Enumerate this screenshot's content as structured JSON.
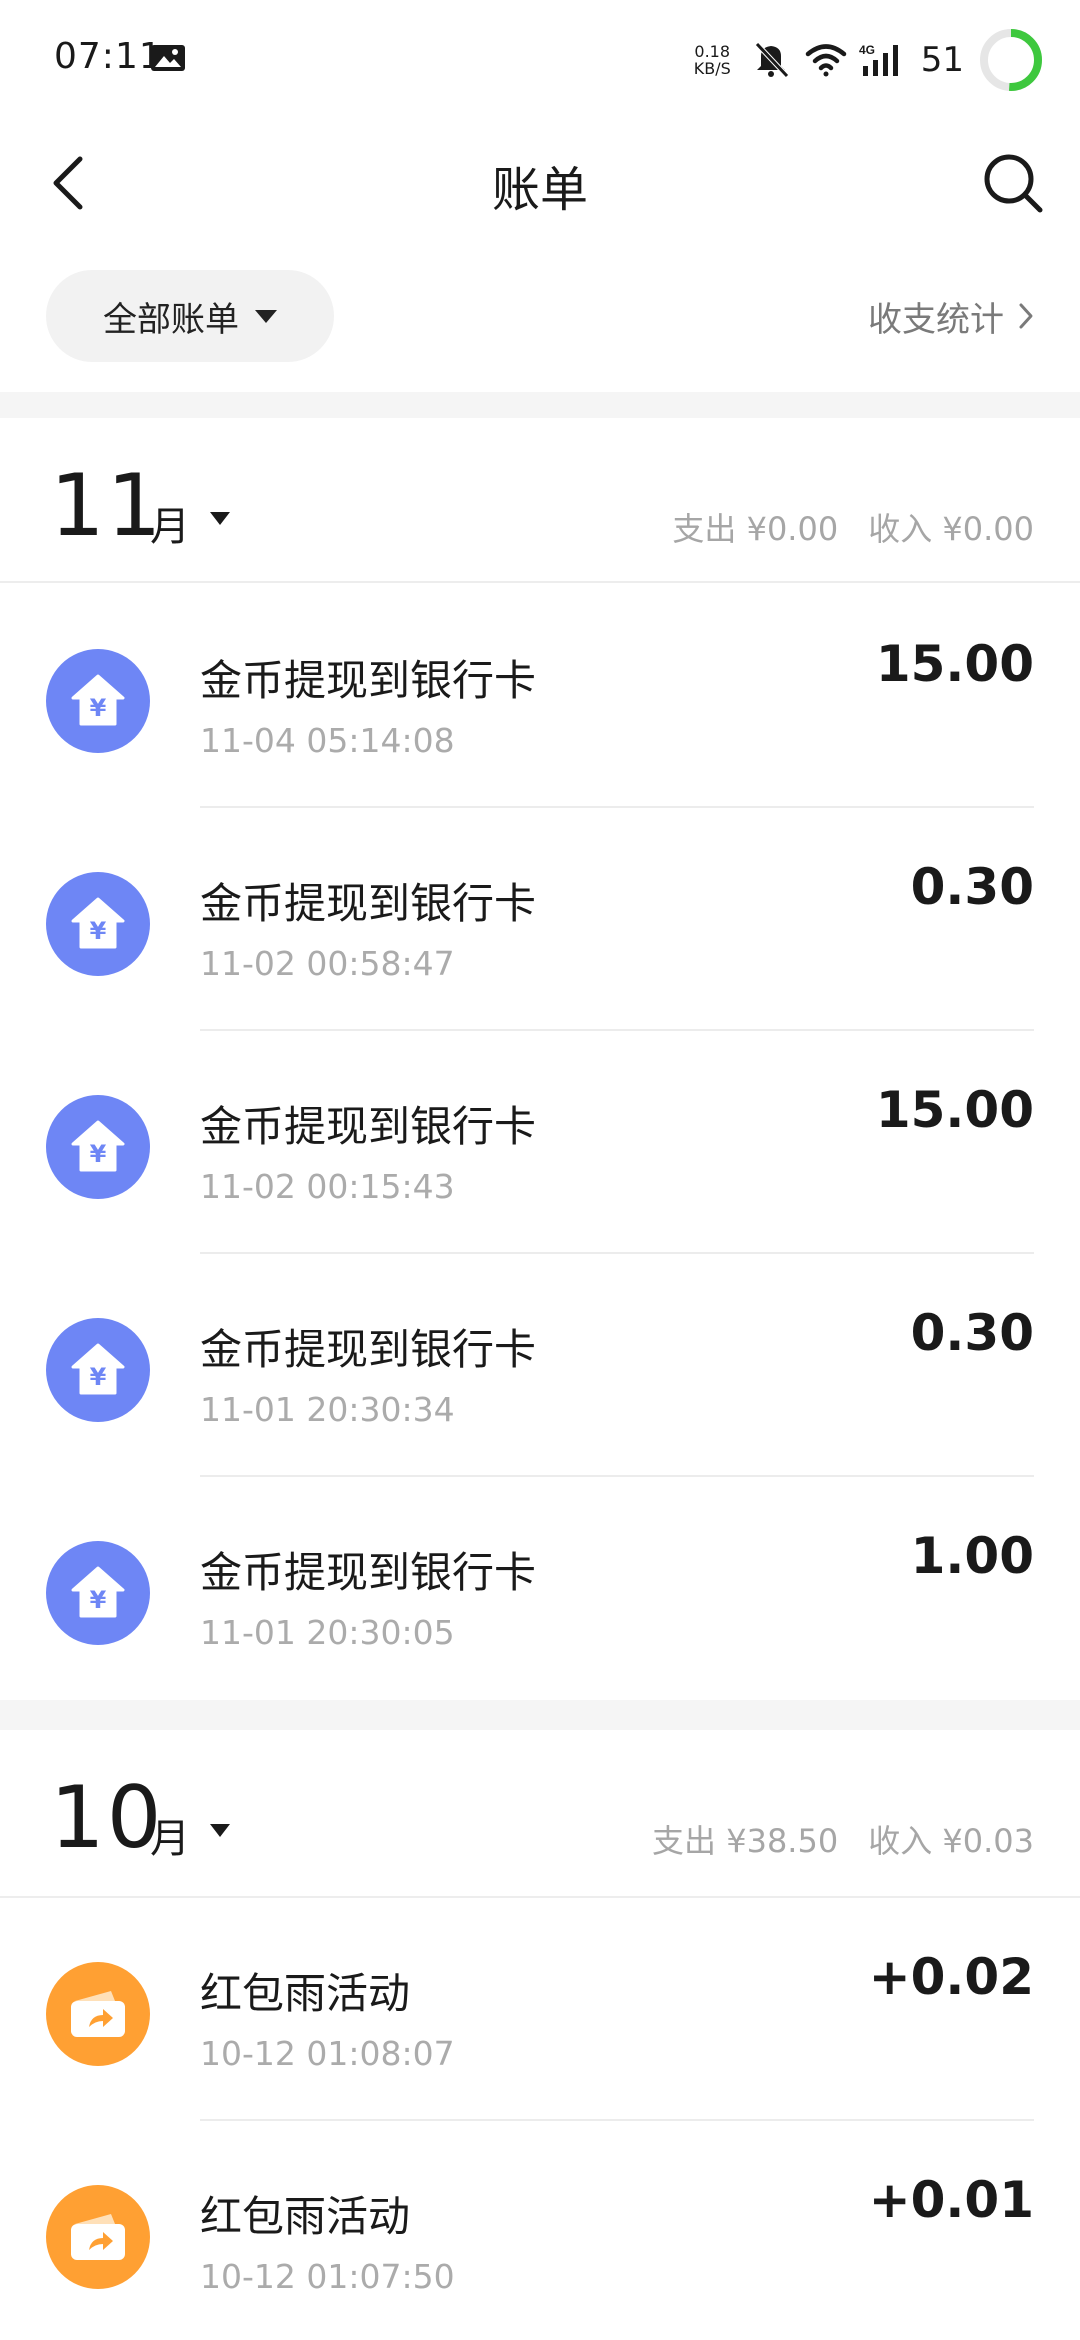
{
  "status_bar": {
    "time": "07:11",
    "net_speed_value": "0.18",
    "net_speed_unit": "KB/S",
    "network_type": "4G",
    "battery": "51",
    "icons": [
      "image-icon",
      "mute-icon",
      "wifi-icon",
      "signal-icon",
      "battery-ring-icon"
    ],
    "battery_color": "#3ec83e"
  },
  "header": {
    "title": "账单",
    "back_icon": "chevron-left-icon",
    "search_icon": "search-icon"
  },
  "filter": {
    "selected": "全部账单",
    "stats_link": "收支统计"
  },
  "colors": {
    "withdraw_icon_bg": "#6e86f5",
    "redpacket_icon_bg": "#ffa033",
    "muted_text": "#a6a6a6"
  },
  "months": [
    {
      "number": "11",
      "unit": "月",
      "expense": "支出 ¥0.00",
      "income": "收入 ¥0.00",
      "transactions": [
        {
          "icon": "yuan-house-icon",
          "title": "金币提现到银行卡",
          "time": "11-04 05:14:08",
          "amount": "15.00"
        },
        {
          "icon": "yuan-house-icon",
          "title": "金币提现到银行卡",
          "time": "11-02 00:58:47",
          "amount": "0.30"
        },
        {
          "icon": "yuan-house-icon",
          "title": "金币提现到银行卡",
          "time": "11-02 00:15:43",
          "amount": "15.00"
        },
        {
          "icon": "yuan-house-icon",
          "title": "金币提现到银行卡",
          "time": "11-01 20:30:34",
          "amount": "0.30"
        },
        {
          "icon": "yuan-house-icon",
          "title": "金币提现到银行卡",
          "time": "11-01 20:30:05",
          "amount": "1.00"
        }
      ]
    },
    {
      "number": "10",
      "unit": "月",
      "expense": "支出 ¥38.50",
      "income": "收入 ¥0.03",
      "transactions": [
        {
          "icon": "wallet-arrow-icon",
          "title": "红包雨活动",
          "time": "10-12 01:08:07",
          "amount": "+0.02"
        },
        {
          "icon": "wallet-arrow-icon",
          "title": "红包雨活动",
          "time": "10-12 01:07:50",
          "amount": "+0.01"
        }
      ]
    }
  ]
}
